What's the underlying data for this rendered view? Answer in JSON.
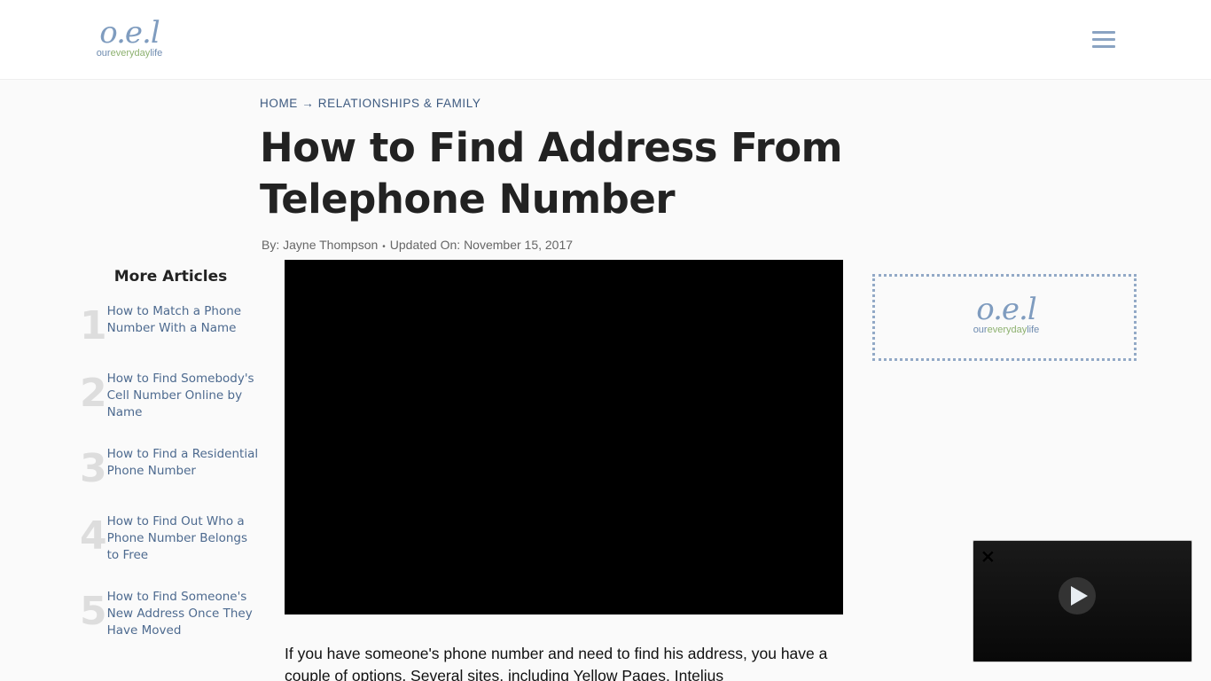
{
  "logo": {
    "mark": "o.e.l",
    "word_a": "our",
    "word_b": "everyday",
    "word_c": "life"
  },
  "header": {
    "menu_icon": "hamburger-icon"
  },
  "breadcrumb": {
    "home": "HOME",
    "arrow": "→",
    "category": "RELATIONSHIPS & FAMILY"
  },
  "article": {
    "title": "How to Find Address From Telephone Number",
    "by_label": "By:",
    "author": "Jayne Thompson",
    "sep": "•",
    "updated_label": "Updated On:",
    "date": "November 15, 2017",
    "body": "If you have someone's phone number and need to find his address, you have a couple of options. Several sites, including Yellow Pages, Intelius"
  },
  "more_articles": {
    "heading": "More Articles",
    "items": [
      {
        "num": "1",
        "title": "How to Match a Phone Number With a Name"
      },
      {
        "num": "2",
        "title": "How to Find Somebody's Cell Number Online by Name"
      },
      {
        "num": "3",
        "title": "How to Find a Residential Phone Number"
      },
      {
        "num": "4",
        "title": "How to Find Out Who a Phone Number Belongs to Free"
      },
      {
        "num": "5",
        "title": "How to Find Someone's New Address Once They Have Moved"
      }
    ]
  },
  "floating_video": {
    "close": "✕"
  }
}
